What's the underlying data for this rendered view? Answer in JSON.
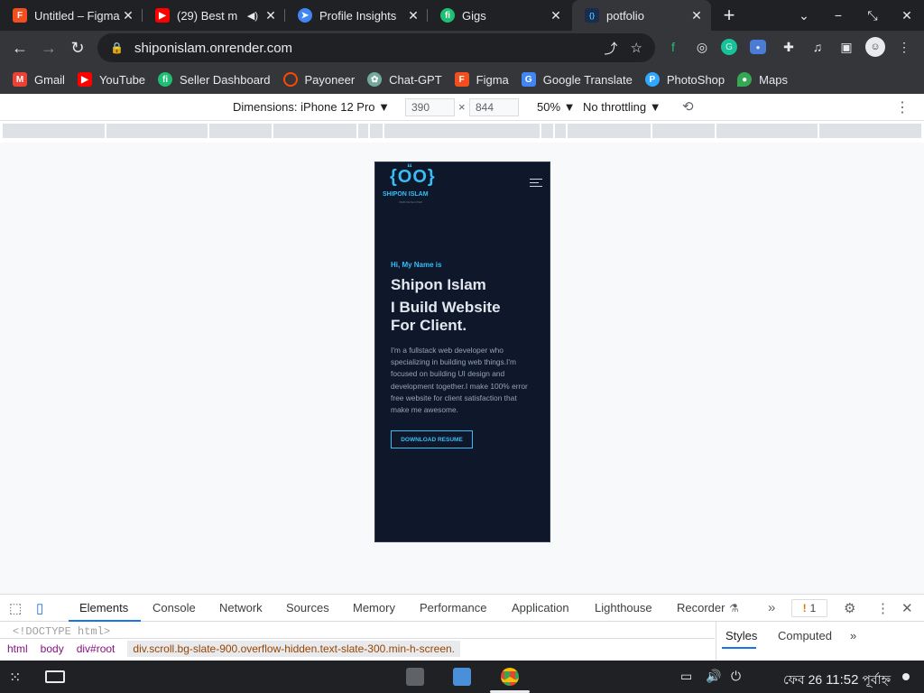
{
  "tabs": [
    {
      "title": "Untitled – Figma",
      "favicon": "figma-icon",
      "color": "#f24e1e"
    },
    {
      "title": "(29) Best m",
      "favicon": "youtube-icon",
      "color": "#ff0000",
      "audio": "speaker-icon"
    },
    {
      "title": "Profile Insights",
      "favicon": "insights-icon",
      "color": "#4285f4"
    },
    {
      "title": "Gigs",
      "favicon": "fiverr-icon",
      "color": "#1dbf73"
    },
    {
      "title": "potfolio",
      "favicon": "portfolio-icon",
      "color": "#1a73e8",
      "active": true
    }
  ],
  "tab_close_glyph": "✕",
  "newtab_glyph": "+",
  "window_controls": [
    "⌄",
    "−",
    "⤡",
    "✕"
  ],
  "address": {
    "url": "shiponislam.onrender.com"
  },
  "toolbar_icons": [
    "fiverr-ext-icon",
    "circle-ext-icon",
    "grammarly-icon",
    "screen-capture-icon",
    "extensions-icon",
    "media-icon",
    "side-panel-icon",
    "profile-avatar",
    "menu-icon"
  ],
  "bookmarks": [
    {
      "label": "Gmail",
      "icon": "gmail-icon",
      "color": "#ea4335"
    },
    {
      "label": "YouTube",
      "icon": "youtube-icon",
      "color": "#ff0000"
    },
    {
      "label": "Seller Dashboard",
      "icon": "fiverr-icon",
      "color": "#1dbf73"
    },
    {
      "label": "Payoneer",
      "icon": "payoneer-icon",
      "color": "#ff4800"
    },
    {
      "label": "Chat-GPT",
      "icon": "chatgpt-icon",
      "color": "#74aa9c"
    },
    {
      "label": "Figma",
      "icon": "figma-icon",
      "color": "#f24e1e"
    },
    {
      "label": "Google Translate",
      "icon": "translate-icon",
      "color": "#4285f4"
    },
    {
      "label": "PhotoShop",
      "icon": "photoshop-icon",
      "color": "#31a8ff"
    },
    {
      "label": "Maps",
      "icon": "maps-icon",
      "color": "#34a853"
    }
  ],
  "device_toolbar": {
    "dimensions_label": "Dimensions: iPhone 12 Pro",
    "width": "390",
    "height": "844",
    "times": "×",
    "zoom": "50%",
    "throttling": "No throttling"
  },
  "page": {
    "logo_braces": "{OO}",
    "logo_quote": "“",
    "logo_name": "SHIPON ISLAM",
    "logo_tagline": "WEB DEVELOPER",
    "greeting": "Hi, My Name is",
    "name": "Shipon Islam",
    "headline_1": "I Build Website",
    "headline_2": "For Client.",
    "bio": "I'm a fullstack web developer who specializing in building web things.I'm focused on building UI design and development together.I make 100% error free website for client satisfaction that make me awesome.",
    "resume_button": "DOWNLOAD RESUME",
    "bg_color": "#0f172a",
    "accent_color": "#38bdf8"
  },
  "devtools": {
    "tabs": [
      "Elements",
      "Console",
      "Network",
      "Sources",
      "Memory",
      "Performance",
      "Application",
      "Lighthouse",
      "Recorder"
    ],
    "active_tab": "Elements",
    "more_tabs": "»",
    "warnings_count": "1",
    "doctype": "<!DOCTYPE html>",
    "breadcrumbs": [
      "html",
      "body",
      "div#root",
      "div.scroll.bg-slate-900.overflow-hidden.text-slate-300.min-h-screen."
    ],
    "side_tabs": [
      "Styles",
      "Computed"
    ],
    "active_side_tab": "Styles"
  },
  "shelf": {
    "date": "ফেব 26",
    "time": "11:52",
    "suffix": "পূর্বাহ্ন",
    "apps": [
      "files-icon",
      "store-icon",
      "chrome-icon"
    ]
  }
}
